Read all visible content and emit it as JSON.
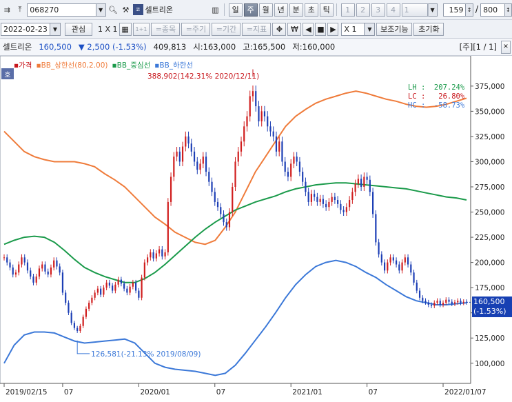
{
  "toolbar": {
    "code": "068270",
    "stock_name": "셀트리온",
    "period_tabs": [
      "일",
      "주",
      "월",
      "년",
      "분",
      "초",
      "틱"
    ],
    "active_period": "주",
    "num_tabs": [
      "1",
      "2",
      "3",
      "4",
      "1"
    ],
    "count_value": "159",
    "slash": "/",
    "total_value": "800",
    "date": "2022-02-23",
    "interest_label": "관심",
    "layout_label": "1 X 1",
    "btn_plus1": "1+1",
    "btn_item": "=종목",
    "btn_cycle": "=주기",
    "btn_period": "=기간",
    "btn_indicator": "=지표",
    "won_label": "₩",
    "multiplier": "X 1",
    "aux_label": "보조기능",
    "reset_label": "초기화"
  },
  "quote": {
    "name": "셀트리온",
    "price": "160,500",
    "change": "▼ 2,500 (-1.53%)",
    "volume": "409,813",
    "open": "시:163,000",
    "high": "고:165,500",
    "low": "저:160,000",
    "page_info": "[주][1 / 1]"
  },
  "chart_legend": {
    "badge": "호",
    "items": [
      "가격",
      "BB_상한선(80,2.00)",
      "BB_중심선",
      "BB_하한선"
    ],
    "colors": {
      "price": "#c8171d",
      "upper": "#ef7b3a",
      "middle": "#1a9a4a",
      "lower": "#3b78d8"
    },
    "lh": "LH :  207.24%",
    "lc": "LC :   26.80%",
    "hc": "HC :  -58.73%"
  },
  "price_tag": {
    "price": "160,500",
    "change": "(-1.53%)"
  },
  "annotations": {
    "high": "388,902(142.31% 2020/12/11)",
    "low": "126,581(-21.13% 2019/08/09)"
  },
  "chart_data": {
    "type": "candlestick",
    "y_ticks": [
      "375,000",
      "350,000",
      "325,000",
      "300,000",
      "275,000",
      "250,000",
      "225,000",
      "200,000",
      "175,000",
      "150,000",
      "125,000",
      "100,000"
    ],
    "y_tick_values": [
      375000,
      350000,
      325000,
      300000,
      275000,
      250000,
      225000,
      200000,
      175000,
      150000,
      125000,
      100000
    ],
    "ylim": [
      80000,
      405000
    ],
    "x_labels": [
      "2019/02/15",
      "07",
      "2020/01",
      "07",
      "2021/01",
      "07",
      "2022/01/07"
    ],
    "x_label_weeks": [
      0,
      20,
      46,
      72,
      98,
      124,
      150
    ],
    "n_weeks": 159,
    "close": [
      205000,
      200000,
      195000,
      188000,
      190000,
      198000,
      205000,
      200000,
      192000,
      186000,
      180000,
      186000,
      194000,
      198000,
      191000,
      188000,
      195000,
      202000,
      196000,
      190000,
      170000,
      160000,
      150000,
      140000,
      135000,
      132000,
      137000,
      146000,
      154000,
      160000,
      165000,
      170000,
      174000,
      168000,
      175000,
      180000,
      177000,
      172000,
      178000,
      183000,
      179000,
      174000,
      170000,
      176000,
      180000,
      172000,
      165000,
      185000,
      200000,
      205000,
      210000,
      204000,
      209000,
      213000,
      206000,
      210000,
      260000,
      285000,
      305000,
      310000,
      300000,
      315000,
      325000,
      318000,
      310000,
      300000,
      292000,
      298000,
      305000,
      290000,
      280000,
      270000,
      260000,
      255000,
      248000,
      240000,
      235000,
      250000,
      275000,
      300000,
      310000,
      320000,
      335000,
      345000,
      365000,
      370000,
      355000,
      340000,
      350000,
      345000,
      335000,
      330000,
      325000,
      310000,
      320000,
      300000,
      290000,
      285000,
      298000,
      305000,
      300000,
      290000,
      280000,
      270000,
      260000,
      268000,
      265000,
      260000,
      263000,
      258000,
      255000,
      260000,
      265000,
      262000,
      258000,
      252000,
      250000,
      255000,
      262000,
      270000,
      278000,
      283000,
      275000,
      285000,
      282000,
      270000,
      248000,
      220000,
      208000,
      200000,
      192000,
      200000,
      205000,
      202000,
      198000,
      192000,
      200000,
      205000,
      198000,
      190000,
      180000,
      172000,
      165000,
      162000,
      160500,
      158000,
      157000,
      160000,
      162000,
      158000,
      160000,
      163000,
      161000,
      159000,
      160500,
      162000,
      160000,
      161000,
      160500
    ],
    "upper": [
      330000,
      320000,
      310000,
      305000,
      302000,
      300000,
      300000,
      300000,
      298000,
      295000,
      288000,
      282000,
      275000,
      265000,
      255000,
      245000,
      238000,
      230000,
      225000,
      220000,
      218000,
      222000,
      235000,
      250000,
      270000,
      290000,
      305000,
      320000,
      335000,
      345000,
      352000,
      358000,
      362000,
      365000,
      368000,
      370000,
      368000,
      365000,
      362000,
      360000,
      357000,
      355000,
      354000,
      355000,
      357000,
      360000,
      363000
    ],
    "middle": [
      218000,
      222000,
      225000,
      226000,
      225000,
      220000,
      212000,
      203000,
      195000,
      190000,
      186000,
      183000,
      180000,
      180000,
      184000,
      190000,
      198000,
      207000,
      216000,
      225000,
      233000,
      240000,
      246000,
      252000,
      256000,
      260000,
      263000,
      266000,
      270000,
      273000,
      275000,
      277000,
      278000,
      279000,
      279000,
      278000,
      277000,
      276000,
      275000,
      274000,
      273000,
      271000,
      269000,
      267000,
      265000,
      264000,
      262000
    ],
    "lower": [
      100000,
      118000,
      128000,
      131000,
      131000,
      130000,
      126000,
      122000,
      120000,
      121000,
      122000,
      123000,
      124000,
      120000,
      110000,
      100000,
      96000,
      94000,
      93000,
      92000,
      90000,
      88000,
      90000,
      98000,
      110000,
      123000,
      136000,
      150000,
      165000,
      178000,
      188000,
      196000,
      200000,
      202000,
      200000,
      196000,
      190000,
      185000,
      178000,
      172000,
      166000,
      162000,
      160000,
      158000,
      158000,
      159000,
      160000
    ]
  }
}
